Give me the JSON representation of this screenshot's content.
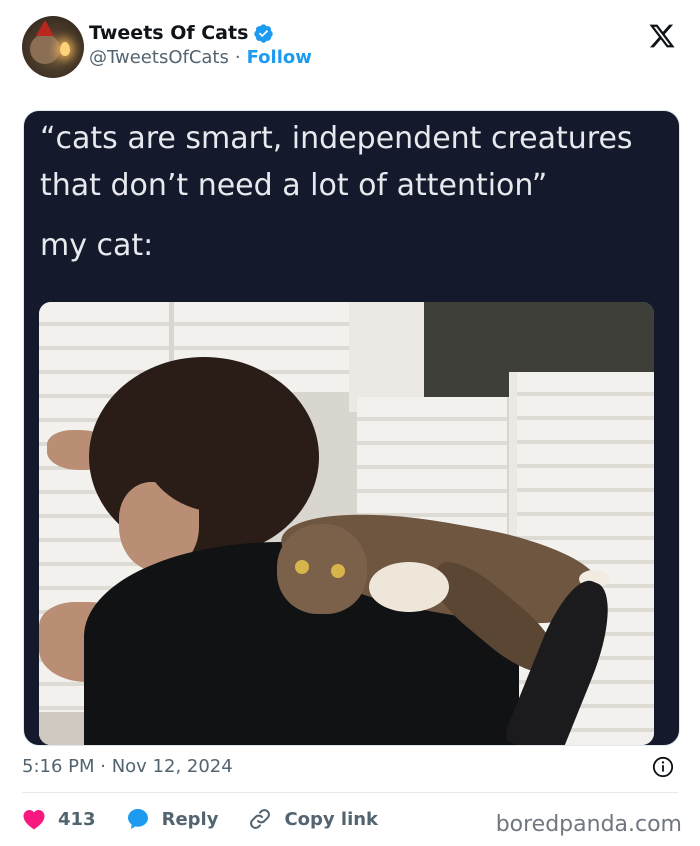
{
  "account": {
    "display_name": "Tweets Of Cats",
    "handle": "@TweetsOfCats",
    "separator": "·",
    "follow_label": "Follow"
  },
  "media_text": {
    "line1": "“cats are smart, independent creatures",
    "line2": "that don’t need a lot of attention”",
    "line3": "my cat:"
  },
  "tweet": {
    "timestamp": "5:16 PM · Nov 12, 2024"
  },
  "actions": {
    "likes_count": "413",
    "reply_label": "Reply",
    "copy_link_label": "Copy link"
  },
  "watermark": "boredpanda.com",
  "icons": {
    "verified": "verified-badge-icon",
    "x_logo": "x-logo-icon",
    "heart": "heart-icon",
    "reply": "reply-bubble-icon",
    "link": "link-icon",
    "info": "info-icon"
  },
  "colors": {
    "accent": "#1d9bf0",
    "like": "#f91880",
    "text_secondary": "#536471",
    "media_bg": "#141a2b"
  }
}
